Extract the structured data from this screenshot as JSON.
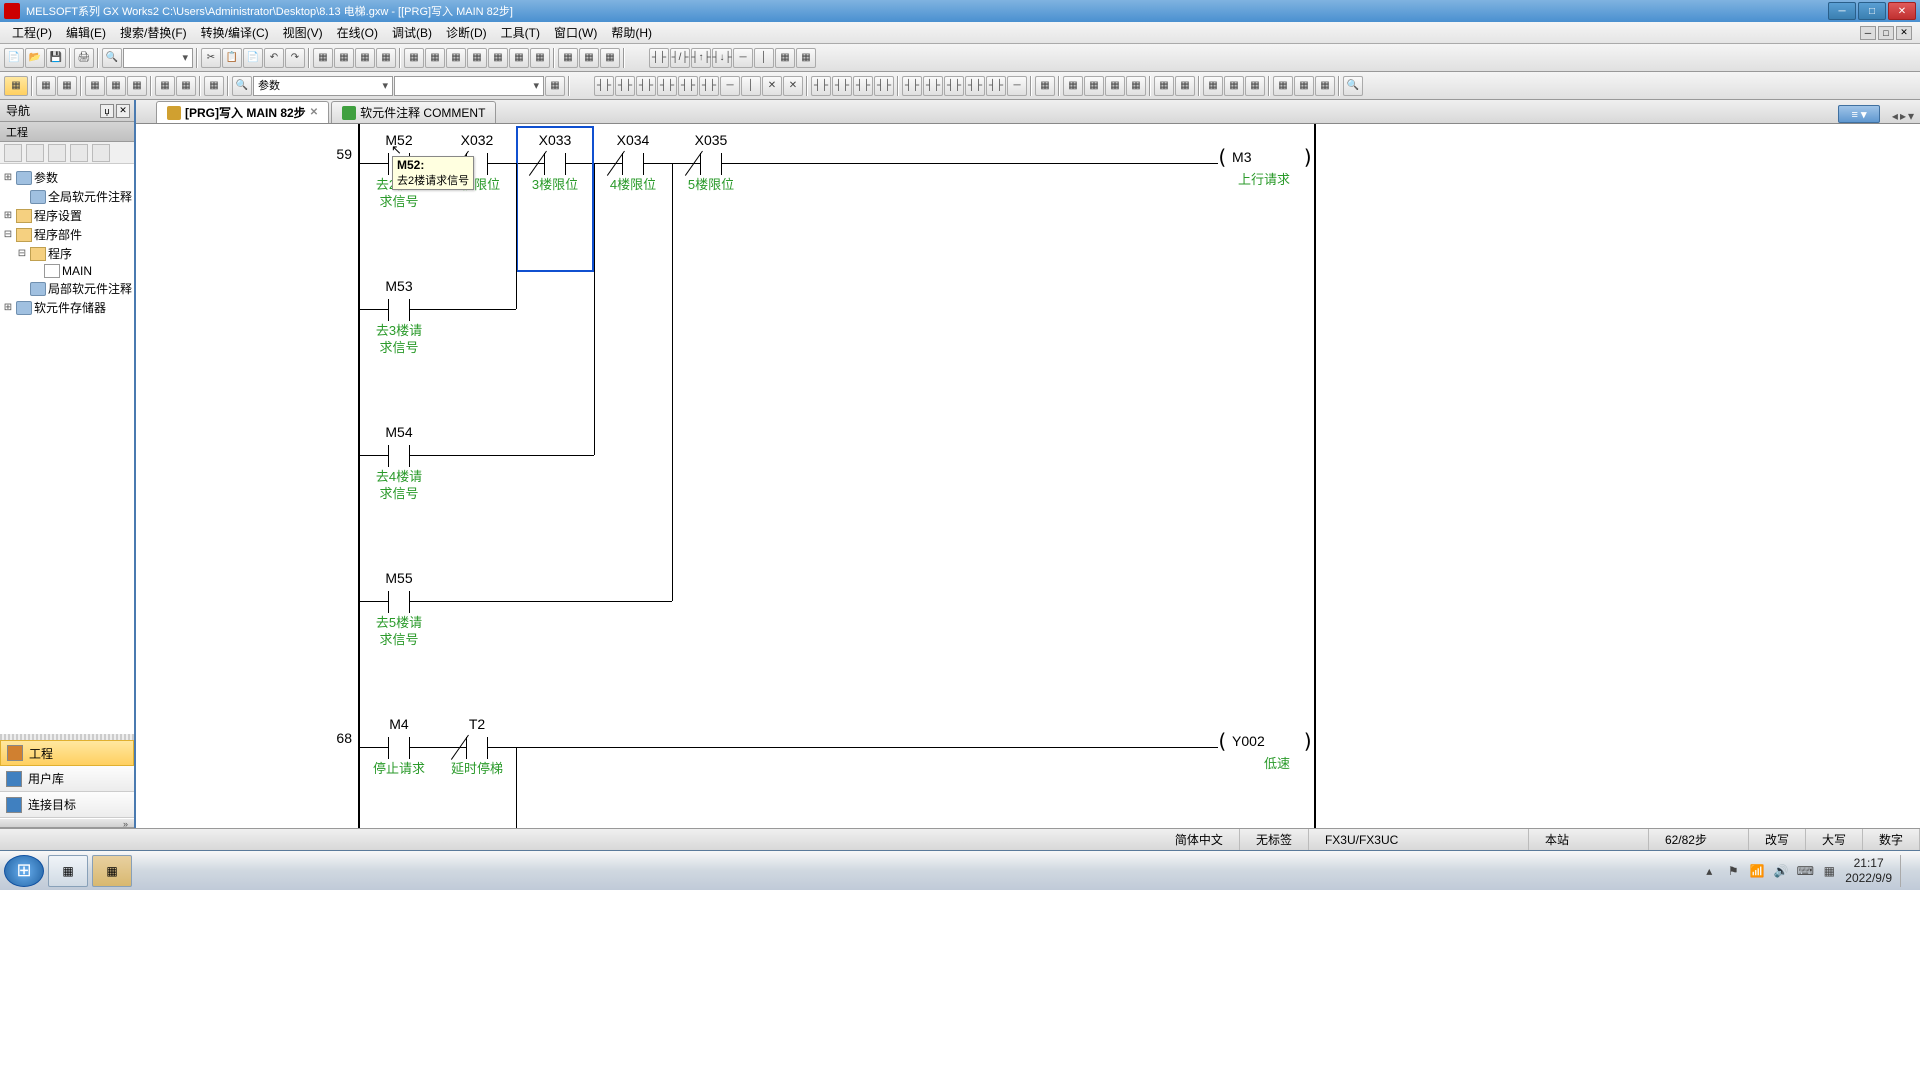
{
  "title": "MELSOFT系列 GX Works2 C:\\Users\\Administrator\\Desktop\\8.13 电梯.gxw - [[PRG]写入 MAIN 82步]",
  "menu": [
    "工程(P)",
    "编辑(E)",
    "搜索/替换(F)",
    "转换/编译(C)",
    "视图(V)",
    "在线(O)",
    "调试(B)",
    "诊断(D)",
    "工具(T)",
    "窗口(W)",
    "帮助(H)"
  ],
  "toolbar2_combo": "参数",
  "nav": {
    "header": "导航",
    "sub": "工程",
    "items": [
      {
        "t": "⊞",
        "icon": "db",
        "label": "参数",
        "cls": ""
      },
      {
        "t": "",
        "icon": "db",
        "label": "全局软元件注释",
        "cls": "indent-1"
      },
      {
        "t": "⊞",
        "icon": "folder",
        "label": "程序设置",
        "cls": ""
      },
      {
        "t": "⊟",
        "icon": "folder",
        "label": "程序部件",
        "cls": ""
      },
      {
        "t": "⊟",
        "icon": "folder",
        "label": "程序",
        "cls": "indent-1"
      },
      {
        "t": "",
        "icon": "file",
        "label": "MAIN",
        "cls": "indent-2"
      },
      {
        "t": "",
        "icon": "db",
        "label": "局部软元件注释",
        "cls": "indent-1"
      },
      {
        "t": "⊞",
        "icon": "db",
        "label": "软元件存储器",
        "cls": ""
      }
    ],
    "buttons": [
      {
        "label": "工程",
        "active": true,
        "color": "#d08030"
      },
      {
        "label": "用户库",
        "active": false,
        "color": "#4080c0"
      },
      {
        "label": "连接目标",
        "active": false,
        "color": "#4080c0"
      }
    ]
  },
  "tabs": [
    {
      "label": "[PRG]写入 MAIN 82步",
      "active": true,
      "icon": ""
    },
    {
      "label": "软元件注释 COMMENT",
      "active": false,
      "icon": "green"
    }
  ],
  "ladder": {
    "step59": "59",
    "step68": "68",
    "row1": [
      {
        "dev": "M52",
        "cmt": "去2楼请求信号",
        "nc": false
      },
      {
        "dev": "X032",
        "cmt": "2楼限位",
        "nc": true
      },
      {
        "dev": "X033",
        "cmt": "3楼限位",
        "nc": true
      },
      {
        "dev": "X034",
        "cmt": "4楼限位",
        "nc": true
      },
      {
        "dev": "X035",
        "cmt": "5楼限位",
        "nc": true
      }
    ],
    "coil1": {
      "dev": "M3",
      "cmt": "上行请求"
    },
    "branches": [
      {
        "dev": "M53",
        "cmt": "去3楼请求信号"
      },
      {
        "dev": "M54",
        "cmt": "去4楼请求信号"
      },
      {
        "dev": "M55",
        "cmt": "去5楼请求信号"
      }
    ],
    "row2": [
      {
        "dev": "M4",
        "cmt": "停止请求",
        "nc": false
      },
      {
        "dev": "T2",
        "cmt": "延时停梯",
        "nc": true
      }
    ],
    "coil2": {
      "dev": "Y002",
      "cmt": "低速"
    },
    "tooltip": {
      "title": "M52:",
      "text": "去2楼请求信号"
    }
  },
  "status": {
    "lang": "简体中文",
    "label": "无标签",
    "cpu": "FX3U/FX3UC",
    "host": "本站",
    "step": "62/82步",
    "ovr": "改写",
    "caps": "大写",
    "num": "数字"
  },
  "tray": {
    "time": "21:17",
    "date": "2022/9/9"
  }
}
